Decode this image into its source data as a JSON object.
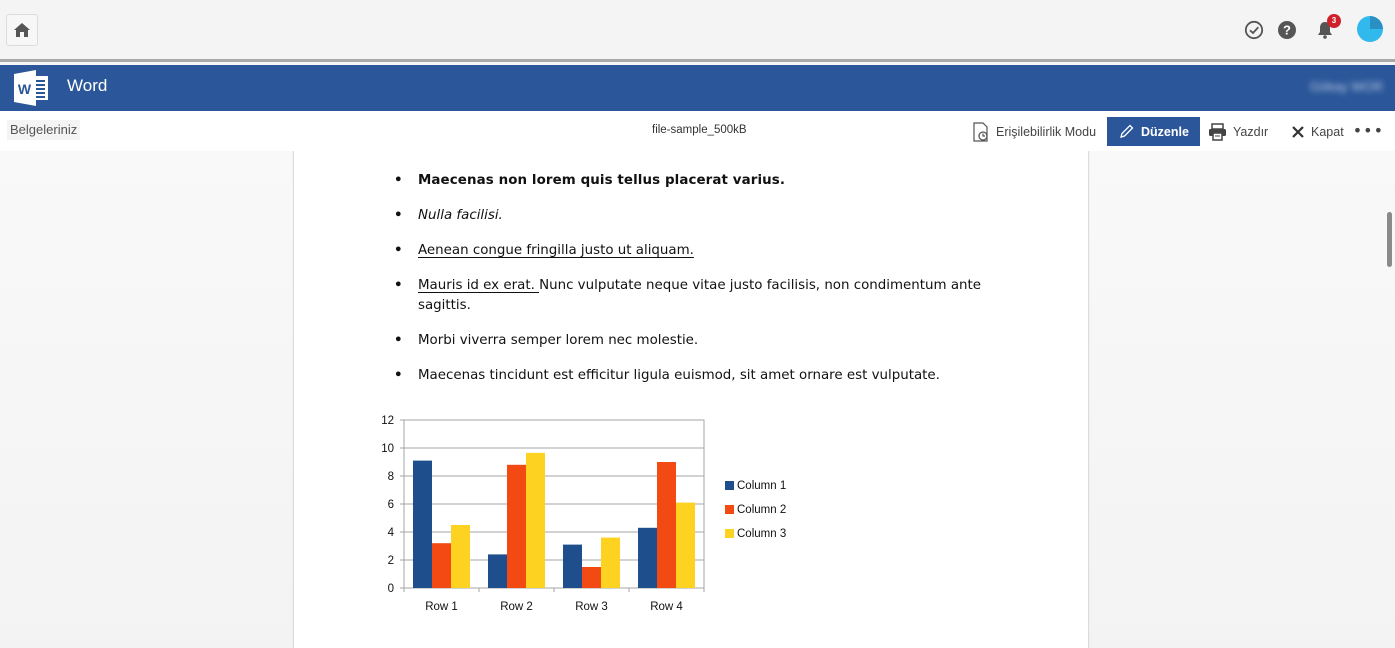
{
  "topbar": {
    "home_icon": "home-icon",
    "icons": [
      "check-circle-icon",
      "help-icon",
      "bell-icon",
      "avatar"
    ],
    "notification_count": "3"
  },
  "appbar": {
    "app_name": "Word",
    "logo": "word-logo-icon",
    "user_name": "Gökay WOR"
  },
  "commandbar": {
    "breadcrumb": "Belgeleriniz",
    "document_title": "file-sample_500kB",
    "accessibility_label": "Erişilebilirlik Modu",
    "edit_label": "Düzenle",
    "print_label": "Yazdır",
    "close_label": "Kapat",
    "more_label": "•••"
  },
  "document": {
    "bullets": [
      {
        "text": "Maecenas non lorem quis tellus placerat varius.",
        "style": "bold"
      },
      {
        "text": "Nulla facilisi.",
        "style": "italic"
      },
      {
        "text": "Aenean congue fringilla justo ut aliquam.",
        "style": "underline"
      },
      {
        "underlined_part": "Mauris id ex erat. ",
        "text": "Nunc vulputate neque vitae justo facilisis, non condimentum ante sagittis.",
        "style": "mixed"
      },
      {
        "text": "Morbi viverra semper lorem nec molestie.",
        "style": "normal"
      },
      {
        "text": "Maecenas tincidunt est efficitur ligula euismod, sit amet ornare est vulputate.",
        "style": "normal"
      }
    ]
  },
  "colors": {
    "brand": "#2b579a",
    "column1": "#1f4e8c",
    "column2": "#f24a12",
    "column3": "#fdd220"
  },
  "chart_data": {
    "type": "bar",
    "title": "",
    "xlabel": "",
    "ylabel": "",
    "categories": [
      "Row 1",
      "Row 2",
      "Row 3",
      "Row 4"
    ],
    "series": [
      {
        "name": "Column 1",
        "values": [
          9.1,
          2.4,
          3.1,
          4.3
        ]
      },
      {
        "name": "Column 2",
        "values": [
          3.2,
          8.8,
          1.5,
          9.0
        ]
      },
      {
        "name": "Column 3",
        "values": [
          4.5,
          9.65,
          3.6,
          6.1
        ]
      }
    ],
    "ylim": [
      0,
      12
    ],
    "yticks": [
      "0",
      "2",
      "4",
      "6",
      "8",
      "10",
      "12"
    ],
    "grid": true,
    "legend": "right"
  }
}
